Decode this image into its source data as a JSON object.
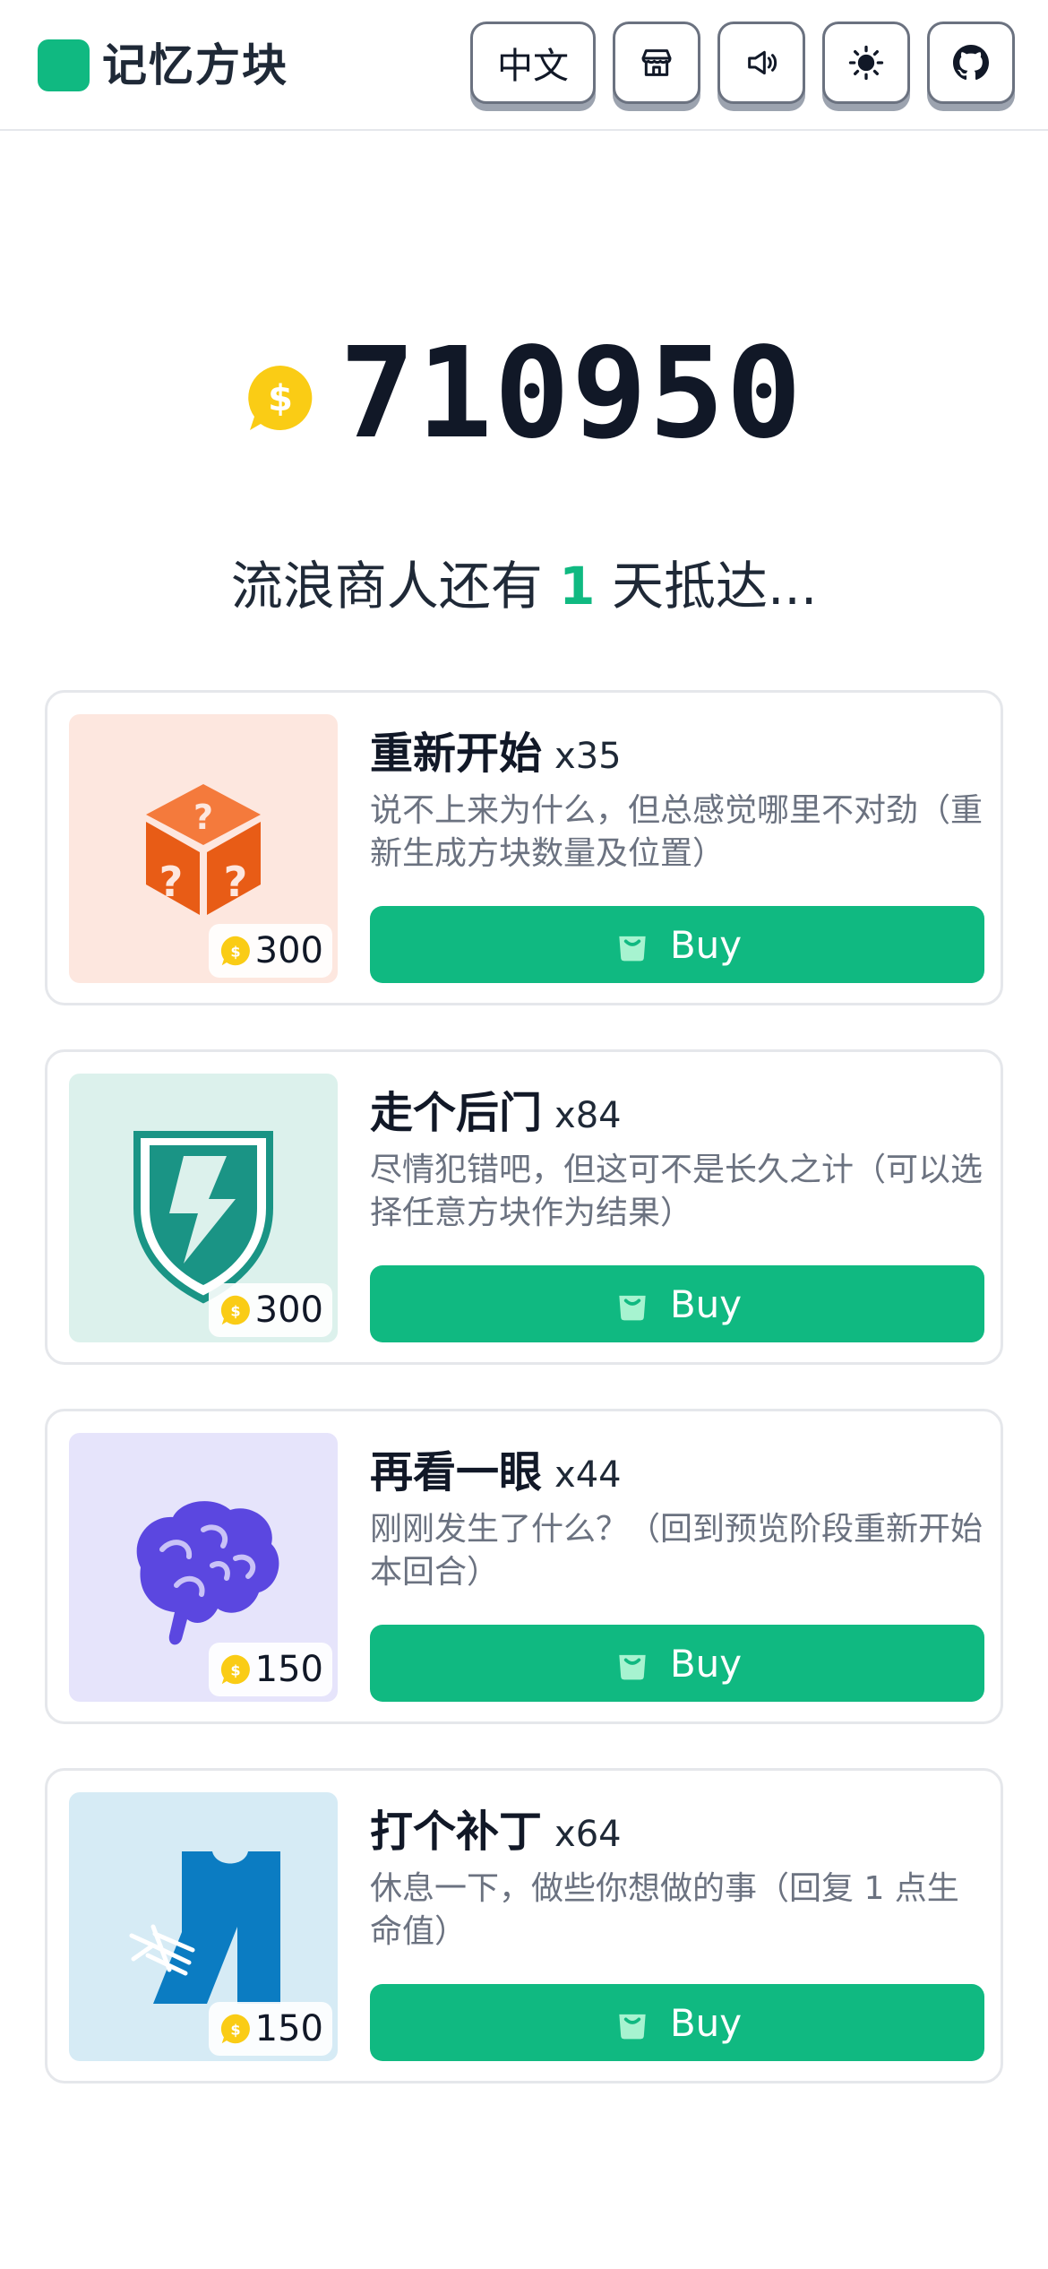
{
  "app": {
    "title": "记忆方块"
  },
  "header": {
    "language_label": "中文",
    "icons": [
      "shop-icon",
      "sound-icon",
      "theme-sun-icon",
      "github-icon"
    ]
  },
  "wallet": {
    "coins": "710950"
  },
  "merchant": {
    "prefix": "流浪商人还有",
    "days": "1",
    "suffix": "天抵达..."
  },
  "colors": {
    "accent": "#10b981",
    "coin": "#facc15",
    "text": "#111827",
    "muted": "#6b7280"
  },
  "items": [
    {
      "name": "重新开始",
      "qty": "x35",
      "description": "说不上来为什么，但总感觉哪里不对劲（重新生成方块数量及位置）",
      "price": "300",
      "buy_label": "Buy",
      "icon": "mystery-box-icon",
      "bg": "#fde7df"
    },
    {
      "name": "走个后门",
      "qty": "x84",
      "description": "尽情犯错吧，但这可不是长久之计（可以选择任意方块作为结果）",
      "price": "300",
      "buy_label": "Buy",
      "icon": "shield-icon",
      "bg": "#dcf1ec"
    },
    {
      "name": "再看一眼",
      "qty": "x44",
      "description": "刚刚发生了什么？（回到预览阶段重新开始本回合）",
      "price": "150",
      "buy_label": "Buy",
      "icon": "brain-icon",
      "bg": "#e6e4fb"
    },
    {
      "name": "打个补丁",
      "qty": "x64",
      "description": "休息一下，做些你想做的事（回复 1 点生命值）",
      "price": "150",
      "buy_label": "Buy",
      "icon": "bandaged-arm-icon",
      "bg": "#d6ebf5"
    }
  ]
}
